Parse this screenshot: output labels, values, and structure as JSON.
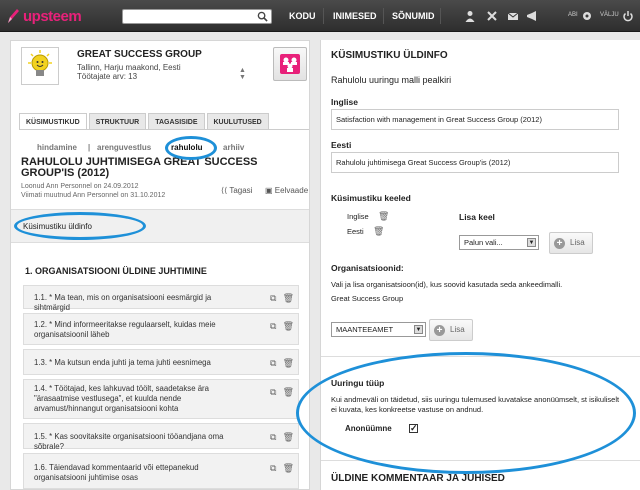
{
  "topbar": {
    "logo": "upsteem",
    "nav": [
      "KODU",
      "INIMESED",
      "SÕNUMID"
    ],
    "help": "ABI",
    "logout": "VÄLJU"
  },
  "org": {
    "name": "GREAT SUCCESS GROUP",
    "location": "Tallinn, Harju maakond, Eesti",
    "employees": "Töötajate arv: 13"
  },
  "tabs": [
    "KÜSIMUSTIKUD",
    "STRUKTUUR",
    "TAGASISIDE",
    "KUULUTUSED"
  ],
  "subnav": {
    "items": [
      "hindamine",
      "arenguvestlus",
      "rahulolu",
      "arhiiv"
    ],
    "sep": "|"
  },
  "survey": {
    "title": "RAHULOLU JUHTIMISEGA GREAT SUCCESS GROUP'IS (2012)",
    "created": "Loonud Ann Personnel on 24.09.2012",
    "modified": "Viimati muutnud Ann Personnel on 31.10.2012",
    "back": "Tagasi",
    "preview": "Eelvaade"
  },
  "section": "Küsimustiku üldinfo",
  "questions": {
    "heading": "1. ORGANISATSIOONI ÜLDINE JUHTIMINE",
    "items": [
      "1.1. * Ma tean, mis on organisatsiooni eesmärgid ja sihtmärgid",
      "1.2. * Mind informeeritakse regulaarselt, kuidas meie organisatsioonil läheb",
      "1.3. * Ma kutsun enda juhti ja tema juhti eesnimega",
      "1.4. * Töötajad, kes lahkuvad töölt, saadetakse ära \"ärasaatmise vestlusega\", et kuulda nende arvamust/hinnangut organisatsiooni kohta",
      "1.5. * Kas soovitaksite organisatsiooni tööandjana oma sõbrale?",
      "1.6. Täiendavad kommentaarid või ettepanekud organisatsiooni juhtimise osas"
    ]
  },
  "right": {
    "heading": "KÜSIMUSTIKU ÜLDINFO",
    "template_title": "Rahulolu uuringu malli pealkiri",
    "lang_en": "Inglise",
    "value_en": "Satisfaction with management in Great Success Group (2012)",
    "lang_et": "Eesti",
    "value_et": "Rahulolu juhtimisega Great Success Group'is (2012)",
    "languages_label": "Küsimustiku keeled",
    "languages": [
      "Inglise",
      "Eesti"
    ],
    "add_language": "Lisa keel",
    "select_placeholder": "Palun vali...",
    "add_button": "Lisa",
    "orgs_label": "Organisatsioonid:",
    "orgs_help": "Vali ja lisa organisatsioon(id), kus soovid kasutada seda ankeedimalli.",
    "org_name": "Great Success Group",
    "org_select": "MAANTEEAMET",
    "survey_type_label": "Uuringu tüüp",
    "survey_type_help": "Kui andmeväli on täidetud, siis uuringu tulemused kuvatakse anonüümselt, st isikuliselt ei kuvata, kes konkreetse vastuse on andnud.",
    "anonymous": "Anonüümne",
    "footer_heading": "ÜLDINE KOMMENTAAR JA JUHISED"
  },
  "colors": {
    "accent": "#e8217a",
    "highlight": "#1e90d8",
    "topbar": "#3a3a3a"
  }
}
